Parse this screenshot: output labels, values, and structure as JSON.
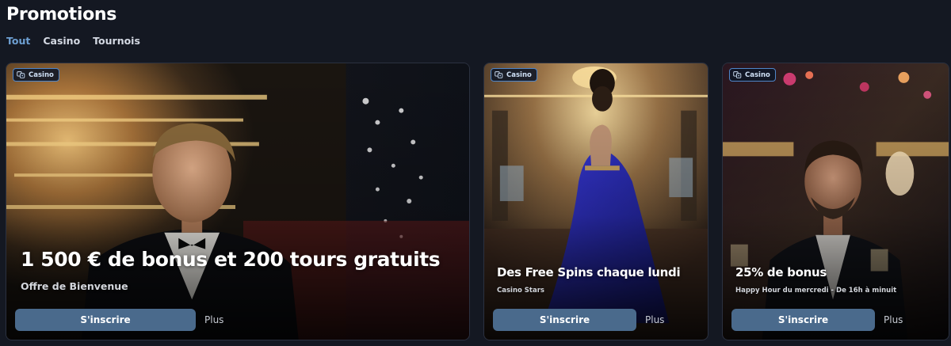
{
  "page": {
    "title": "Promotions"
  },
  "tabs": [
    {
      "label": "Tout",
      "active": true
    },
    {
      "label": "Casino",
      "active": false
    },
    {
      "label": "Tournois",
      "active": false
    }
  ],
  "colors": {
    "accent": "#6ea0d3",
    "button": "#4a6a8c",
    "background": "#141822",
    "badge_border": "#4f86c9"
  },
  "promotions": [
    {
      "badge": {
        "icon": "dice-icon",
        "label": "Casino"
      },
      "headline": "1 500 € de bonus et 200 tours gratuits",
      "subtitle": "Offre de Bienvenue",
      "cta": "S'inscrire",
      "more": "Plus",
      "image": "man-in-tuxedo-casino-lights"
    },
    {
      "badge": {
        "icon": "dice-icon",
        "label": "Casino"
      },
      "headline": "Des Free Spins chaque lundi",
      "subtitle": "Casino Stars",
      "cta": "S'inscrire",
      "more": "Plus",
      "image": "woman-in-blue-gown-casino-hall"
    },
    {
      "badge": {
        "icon": "dice-icon",
        "label": "Casino"
      },
      "headline": "25% de bonus",
      "subtitle": "Happy Hour du mercredi - De 16h à minuit",
      "cta": "S'inscrire",
      "more": "Plus",
      "image": "man-with-drink-casino-night"
    }
  ]
}
